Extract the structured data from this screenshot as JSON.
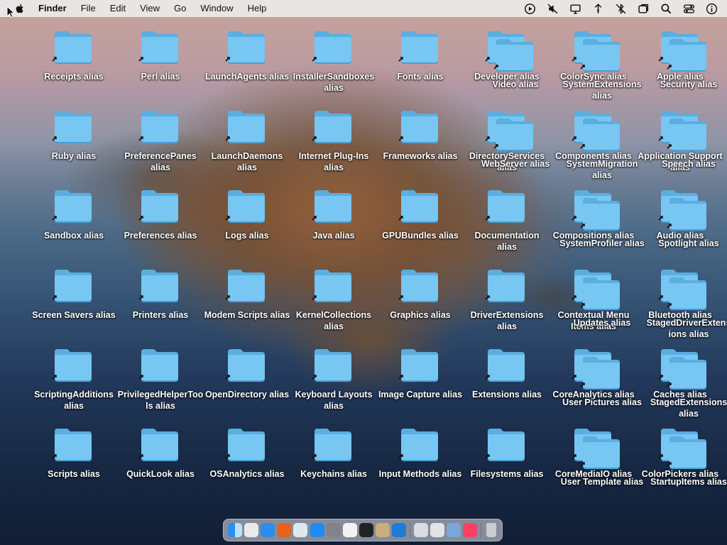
{
  "menubar": {
    "items": [
      "Finder",
      "File",
      "Edit",
      "View",
      "Go",
      "Window",
      "Help"
    ],
    "status_icons": [
      "play-circle-icon",
      "mute-icon",
      "display-icon",
      "network-icon",
      "bluetooth-off-icon",
      "window-icon",
      "search-icon",
      "control-center-icon",
      "info-icon"
    ]
  },
  "desktop": {
    "folders": [
      {
        "label": "Receipts alias"
      },
      {
        "label": "Perl alias"
      },
      {
        "label": "LaunchAgents alias"
      },
      {
        "label": "InstallerSandboxes alias"
      },
      {
        "label": "Fonts alias"
      },
      {
        "label": "Developer alias"
      },
      {
        "label": "ColorSync alias"
      },
      {
        "label": "Apple alias"
      },
      {
        "label": "Ruby alias"
      },
      {
        "label": "PreferencePanes alias"
      },
      {
        "label": "LaunchDaemons alias"
      },
      {
        "label": "Internet Plug-Ins alias"
      },
      {
        "label": "Frameworks alias"
      },
      {
        "label": "DirectoryServices alias"
      },
      {
        "label": "Components alias"
      },
      {
        "label": "Application Support alias"
      },
      {
        "label": "Sandbox alias"
      },
      {
        "label": "Preferences alias"
      },
      {
        "label": "Logs alias"
      },
      {
        "label": "Java alias"
      },
      {
        "label": "GPUBundles alias"
      },
      {
        "label": "Documentation alias"
      },
      {
        "label": "Compositions alias"
      },
      {
        "label": "Audio alias"
      },
      {
        "label": "Screen Savers alias"
      },
      {
        "label": "Printers alias"
      },
      {
        "label": "Modem Scripts alias"
      },
      {
        "label": "KernelCollections alias"
      },
      {
        "label": "Graphics alias"
      },
      {
        "label": "DriverExtensions alias"
      },
      {
        "label": "Contextual Menu Items alias"
      },
      {
        "label": "Bluetooth alias"
      },
      {
        "label": "ScriptingAdditions alias"
      },
      {
        "label": "PrivilegedHelperTools alias"
      },
      {
        "label": "OpenDirectory alias"
      },
      {
        "label": "Keyboard Layouts alias"
      },
      {
        "label": "Image Capture alias"
      },
      {
        "label": "Extensions alias"
      },
      {
        "label": "CoreAnalytics alias"
      },
      {
        "label": "Caches alias"
      },
      {
        "label": "Scripts alias"
      },
      {
        "label": "QuickLook alias"
      },
      {
        "label": "OSAnalytics alias"
      },
      {
        "label": "Keychains alias"
      },
      {
        "label": "Input Methods alias"
      },
      {
        "label": "Filesystems alias"
      },
      {
        "label": "CoreMediaIO alias"
      },
      {
        "label": "ColorPickers alias"
      }
    ],
    "overlap_folders": [
      {
        "label": "Video alias"
      },
      {
        "label": "SystemExtensions alias"
      },
      {
        "label": "Security alias"
      },
      {
        "label": "WebServer alias"
      },
      {
        "label": "SystemMigration alias"
      },
      {
        "label": "Speech alias"
      },
      {
        "label": "SystemProfiler alias"
      },
      {
        "label": "Spotlight alias"
      },
      {
        "label": "Updates alias"
      },
      {
        "label": "StagedDriverExtensions alias"
      },
      {
        "label": "User Pictures alias"
      },
      {
        "label": "StagedExtensions alias"
      },
      {
        "label": "User Template alias"
      },
      {
        "label": "StartupItems alias"
      }
    ]
  },
  "dock": {
    "apps": [
      {
        "name": "finder-icon",
        "color": "#2f8fe8"
      },
      {
        "name": "launchpad-icon",
        "color": "#e9e9ee"
      },
      {
        "name": "safari-icon",
        "color": "#2d8cf0"
      },
      {
        "name": "firefox-icon",
        "color": "#e8621c"
      },
      {
        "name": "chrome-icon",
        "color": "#dfe7ef"
      },
      {
        "name": "app-store-icon",
        "color": "#1e8cf2"
      },
      {
        "name": "system-preferences-icon",
        "color": "#808389"
      },
      {
        "name": "textedit-icon",
        "color": "#f3f3f3"
      },
      {
        "name": "terminal-icon",
        "color": "#222222"
      },
      {
        "name": "script-editor-icon",
        "color": "#c9ad7a"
      },
      {
        "name": "vscode-icon",
        "color": "#1f7bd3"
      },
      {
        "name": "preview-icon",
        "color": "#d9dde2"
      },
      {
        "name": "instruments-icon",
        "color": "#e0e3e8"
      },
      {
        "name": "migration-assistant-icon",
        "color": "#7aa6d8"
      },
      {
        "name": "music-icon",
        "color": "#fa4161"
      },
      {
        "name": "trash-icon",
        "color": "#c9ccd1"
      }
    ]
  }
}
